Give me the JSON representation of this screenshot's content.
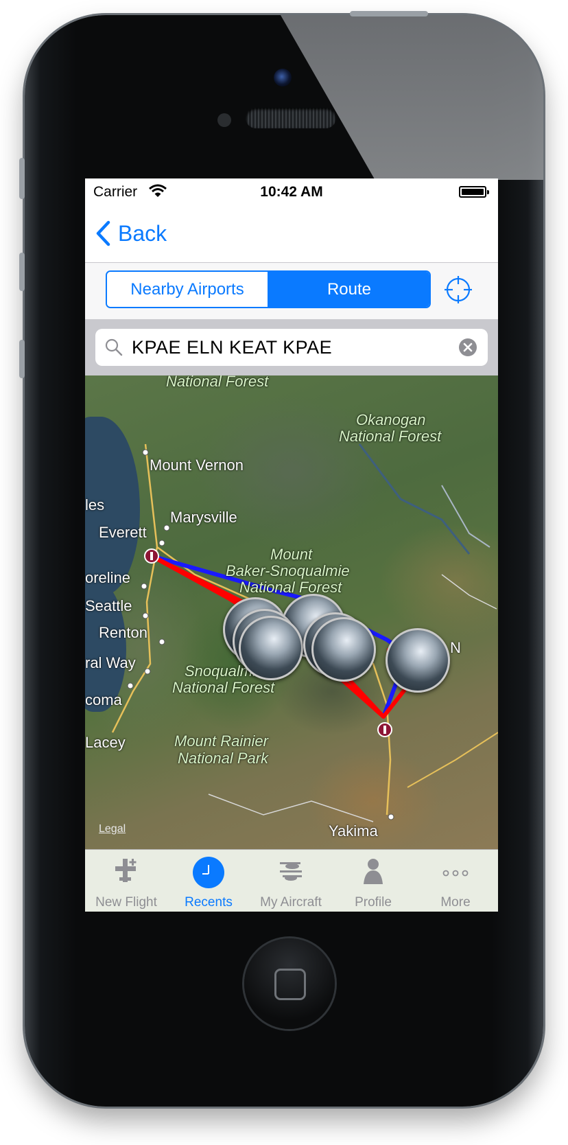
{
  "status_bar": {
    "carrier": "Carrier",
    "time": "10:42 AM"
  },
  "nav": {
    "back_label": "Back"
  },
  "segmented": {
    "options": [
      "Nearby Airports",
      "Route"
    ],
    "selected": "Route"
  },
  "search": {
    "value": "KPAE ELN KEAT KPAE"
  },
  "map": {
    "labels": {
      "forest_top": "National Forest",
      "okanogan": "Okanogan",
      "okanogan_nf": "National Forest",
      "mount_vernon": "Mount Vernon",
      "les": "les",
      "marysville": "Marysville",
      "everett": "Everett",
      "mount": "Mount",
      "baker": "Baker-Snoqualmie",
      "baker_nf": "National Forest",
      "oreline": "oreline",
      "seattle": "Seattle",
      "renton": "Renton",
      "ral_way": "ral Way",
      "snoqualmie": "Snoqualmi",
      "snoq_nf": "National Forest",
      "coma": "coma",
      "lacey": "Lacey",
      "rainier": "Mount Rainier",
      "rainier_park": "National Park",
      "yakima": "Yakima",
      "n_edge": "N"
    },
    "legal": "Legal",
    "route_colors": {
      "outbound": "#1a1aff",
      "return": "#ff0000"
    },
    "waypoint_color": "#8d1535"
  },
  "tabs": [
    {
      "label": "New Flight",
      "icon": "new-flight-icon",
      "active": false
    },
    {
      "label": "Recents",
      "icon": "clock-icon",
      "active": true
    },
    {
      "label": "My Aircraft",
      "icon": "aircraft-icon",
      "active": false
    },
    {
      "label": "Profile",
      "icon": "profile-icon",
      "active": false
    },
    {
      "label": "More",
      "icon": "more-icon",
      "active": false
    }
  ],
  "colors": {
    "accent": "#0a7aff",
    "inactive_tab": "#8e8e93"
  }
}
